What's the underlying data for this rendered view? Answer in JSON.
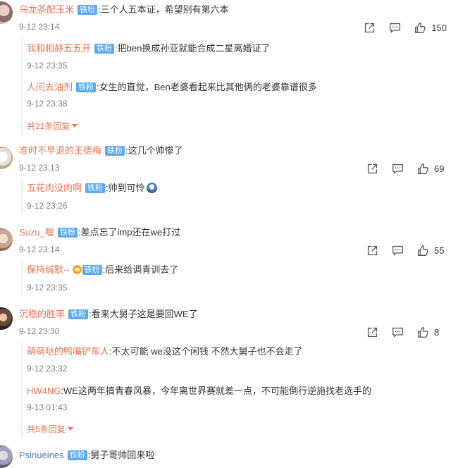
{
  "comments": [
    {
      "user": "乌龙茶配玉米",
      "badge": "铁粉",
      "text": "三个人五本证，希望别有第六本",
      "time": "9-12 23:14",
      "likes": "150",
      "replies": [
        {
          "user": "我和相赫五五开",
          "badge": "铁粉",
          "text": "把ben换成孙亚就能合成二星离婚证了",
          "time": "9-12 23:35"
        },
        {
          "user": "人间去油剂",
          "badge": "铁粉",
          "text": "女生的直觉，Ben老婆看起来比其他俩的老婆靠谱很多",
          "time": "9-12 23:38"
        }
      ],
      "more": "共21条回复"
    },
    {
      "user": "准时不早退的王德梅",
      "badge": "铁粉",
      "text": "这几个帅惨了",
      "time": "9-12 23:13",
      "likes": "69",
      "replies": [
        {
          "user": "五花肉没肉啊",
          "badge": "铁粉",
          "text": "帅到可怜",
          "time": "9-12 23:26"
        }
      ]
    },
    {
      "user": "Suzu_喔",
      "badge": "铁粉",
      "text": "差点忘了imp还在we打过",
      "time": "9-12 23:14",
      "likes": "55",
      "replies": [
        {
          "user": "保持缄默--",
          "badge": "铁粉",
          "text": "后来给调青训去了",
          "time": "9-12 23:35"
        }
      ]
    },
    {
      "user": "沉稳的胜率",
      "badge": "铁粉",
      "text": "看来大舅子这是要回WE了",
      "time": "9-12 23:30",
      "likes": "8",
      "replies": [
        {
          "user": "萌萌哒的鸭嘴铲车人",
          "badge": "",
          "text": "不太可能 we没这个闲钱 不然大舅子也不会走了",
          "time": "9-12 23:32"
        },
        {
          "user": "HW4NG",
          "badge": "",
          "text": "WE这两年搞青春风暴，今年离世界赛就差一点，不可能倒行逆施找老选手的",
          "time": "9-13 01:43"
        }
      ],
      "more": "共5条回复"
    },
    {
      "user": "Psinueines",
      "badge": "铁粉",
      "text": "舅子哥帅回来啦"
    }
  ],
  "icons": {
    "share": "share-icon",
    "comment": "comment-icon",
    "like": "thumbs-up-icon"
  }
}
